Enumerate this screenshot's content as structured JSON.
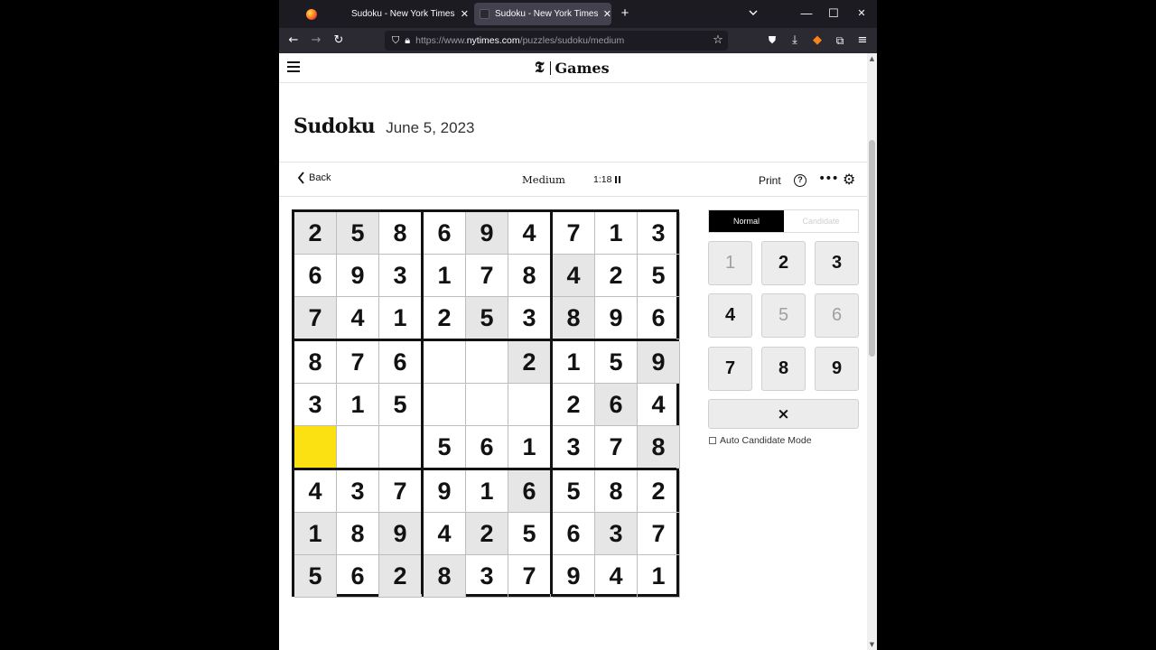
{
  "browser": {
    "tabs": [
      {
        "title": "Sudoku - New York Times Num"
      },
      {
        "title": "Sudoku - New York Times Num"
      }
    ],
    "new_tab": "+",
    "url": {
      "prefix": "https://www.",
      "domain": "nytimes.com",
      "path": "/puzzles/sudoku/medium"
    },
    "window_controls": {
      "minimize": "—",
      "maximize": "☐",
      "close": "✕",
      "list_all_tabs": "⌄"
    }
  },
  "site": {
    "logo_t": "𝕿",
    "logo_text": "Games"
  },
  "header": {
    "title": "Sudoku",
    "date": "June 5, 2023"
  },
  "toolbar": {
    "back_label": "Back",
    "difficulty": "Medium",
    "timer": "1:18",
    "print_label": "Print",
    "help_label": "?",
    "more_label": "•••",
    "settings_label": "⚙"
  },
  "board": {
    "rows": [
      [
        "2",
        "5",
        "8",
        "6",
        "9",
        "4",
        "7",
        "1",
        "3"
      ],
      [
        "6",
        "9",
        "3",
        "1",
        "7",
        "8",
        "4",
        "2",
        "5"
      ],
      [
        "7",
        "4",
        "1",
        "2",
        "5",
        "3",
        "8",
        "9",
        "6"
      ],
      [
        "8",
        "7",
        "6",
        "",
        "",
        "2",
        "1",
        "5",
        "9"
      ],
      [
        "3",
        "1",
        "5",
        "",
        "",
        "",
        "2",
        "6",
        "4"
      ],
      [
        "",
        "",
        "",
        "5",
        "6",
        "1",
        "3",
        "7",
        "8"
      ],
      [
        "4",
        "3",
        "7",
        "9",
        "1",
        "6",
        "5",
        "8",
        "2"
      ],
      [
        "1",
        "8",
        "9",
        "4",
        "2",
        "5",
        "6",
        "3",
        "7"
      ],
      [
        "5",
        "6",
        "2",
        "8",
        "3",
        "7",
        "9",
        "4",
        "1"
      ]
    ],
    "shaded": [
      [
        true,
        true,
        false,
        false,
        true,
        false,
        false,
        false,
        false
      ],
      [
        false,
        false,
        false,
        false,
        false,
        false,
        true,
        false,
        false
      ],
      [
        true,
        false,
        false,
        false,
        true,
        false,
        true,
        false,
        false
      ],
      [
        false,
        false,
        false,
        false,
        false,
        true,
        false,
        false,
        true
      ],
      [
        false,
        false,
        false,
        false,
        false,
        false,
        false,
        true,
        false
      ],
      [
        false,
        false,
        false,
        false,
        false,
        false,
        false,
        false,
        true
      ],
      [
        false,
        false,
        false,
        false,
        false,
        true,
        false,
        false,
        false
      ],
      [
        true,
        false,
        true,
        false,
        true,
        false,
        false,
        true,
        false
      ],
      [
        true,
        false,
        true,
        true,
        false,
        false,
        false,
        false,
        false
      ]
    ],
    "selected": {
      "row": 5,
      "col": 0
    }
  },
  "controls": {
    "mode_normal": "Normal",
    "mode_candidate": "Candidate",
    "keys": [
      {
        "label": "1",
        "done": true
      },
      {
        "label": "2",
        "done": false
      },
      {
        "label": "3",
        "done": false
      },
      {
        "label": "4",
        "done": false
      },
      {
        "label": "5",
        "done": true
      },
      {
        "label": "6",
        "done": true
      },
      {
        "label": "7",
        "done": false
      },
      {
        "label": "8",
        "done": false
      },
      {
        "label": "9",
        "done": false
      }
    ],
    "erase_label": "×",
    "auto_candidate_label": "Auto Candidate Mode"
  },
  "colors": {
    "selected_cell": "#fbe012",
    "shaded_cell": "#e6e6e6",
    "mode_active": "#000000"
  }
}
